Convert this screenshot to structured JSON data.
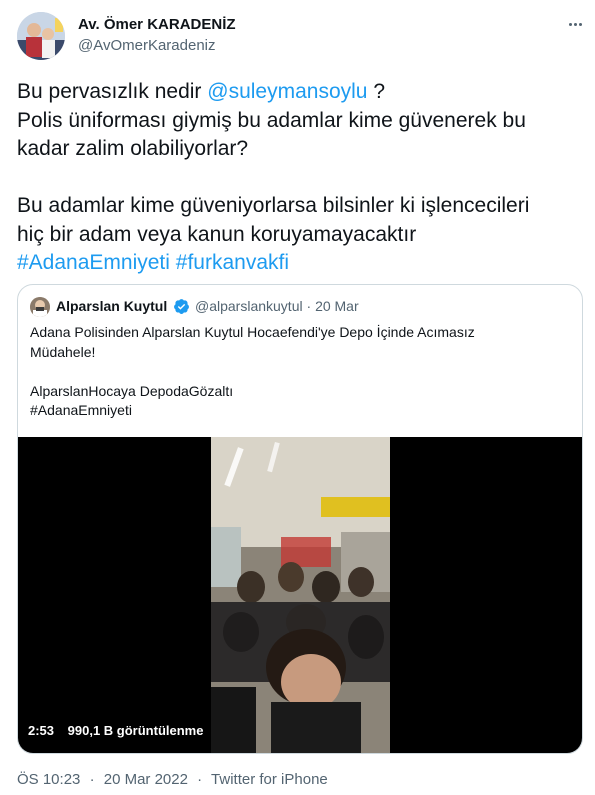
{
  "author": {
    "name": "Av. Ömer KARADENİZ",
    "handle": "@AvOmerKaradeniz"
  },
  "tweet": {
    "line1_prefix": "Bu pervasızlık  nedir ",
    "mention": "@suleymansoylu",
    "line1_suffix": " ?",
    "line2": "Polis üniforması giymiş bu adamlar kime güvenerek bu",
    "line3": "kadar zalim olabiliyorlar?",
    "line4": "Bu adamlar kime güveniyorlarsa bilsinler ki işlencecileri",
    "line5": "hiç bir adam veya kanun koruyamayacaktır",
    "hashtag1": "#AdanaEmniyeti",
    "hashtag2": "#furkanvakfi"
  },
  "quote": {
    "name": "Alparslan Kuytul",
    "handle": "@alparslankuytul",
    "separator": "·",
    "date": "20 Mar",
    "line1": "Adana Polisinden Alparslan Kuytul Hocaefendi'ye Depo İçinde Acımasız",
    "line2": "Müdahele!",
    "line3": "AlparslanHocaya DepodaGözaltı",
    "line4": "#AdanaEmniyeti",
    "video": {
      "duration": "2:53",
      "views": "990,1 B görüntülenme"
    }
  },
  "footer": {
    "time": "ÖS 10:23",
    "separator1": "·",
    "date": "20 Mar 2022",
    "separator2": "·",
    "source": "Twitter for iPhone"
  },
  "icons": {
    "more": "more-icon",
    "verified": "verified-badge-icon"
  },
  "colors": {
    "link": "#1d9bf0",
    "secondary": "#536471",
    "border": "#cfd9de"
  }
}
